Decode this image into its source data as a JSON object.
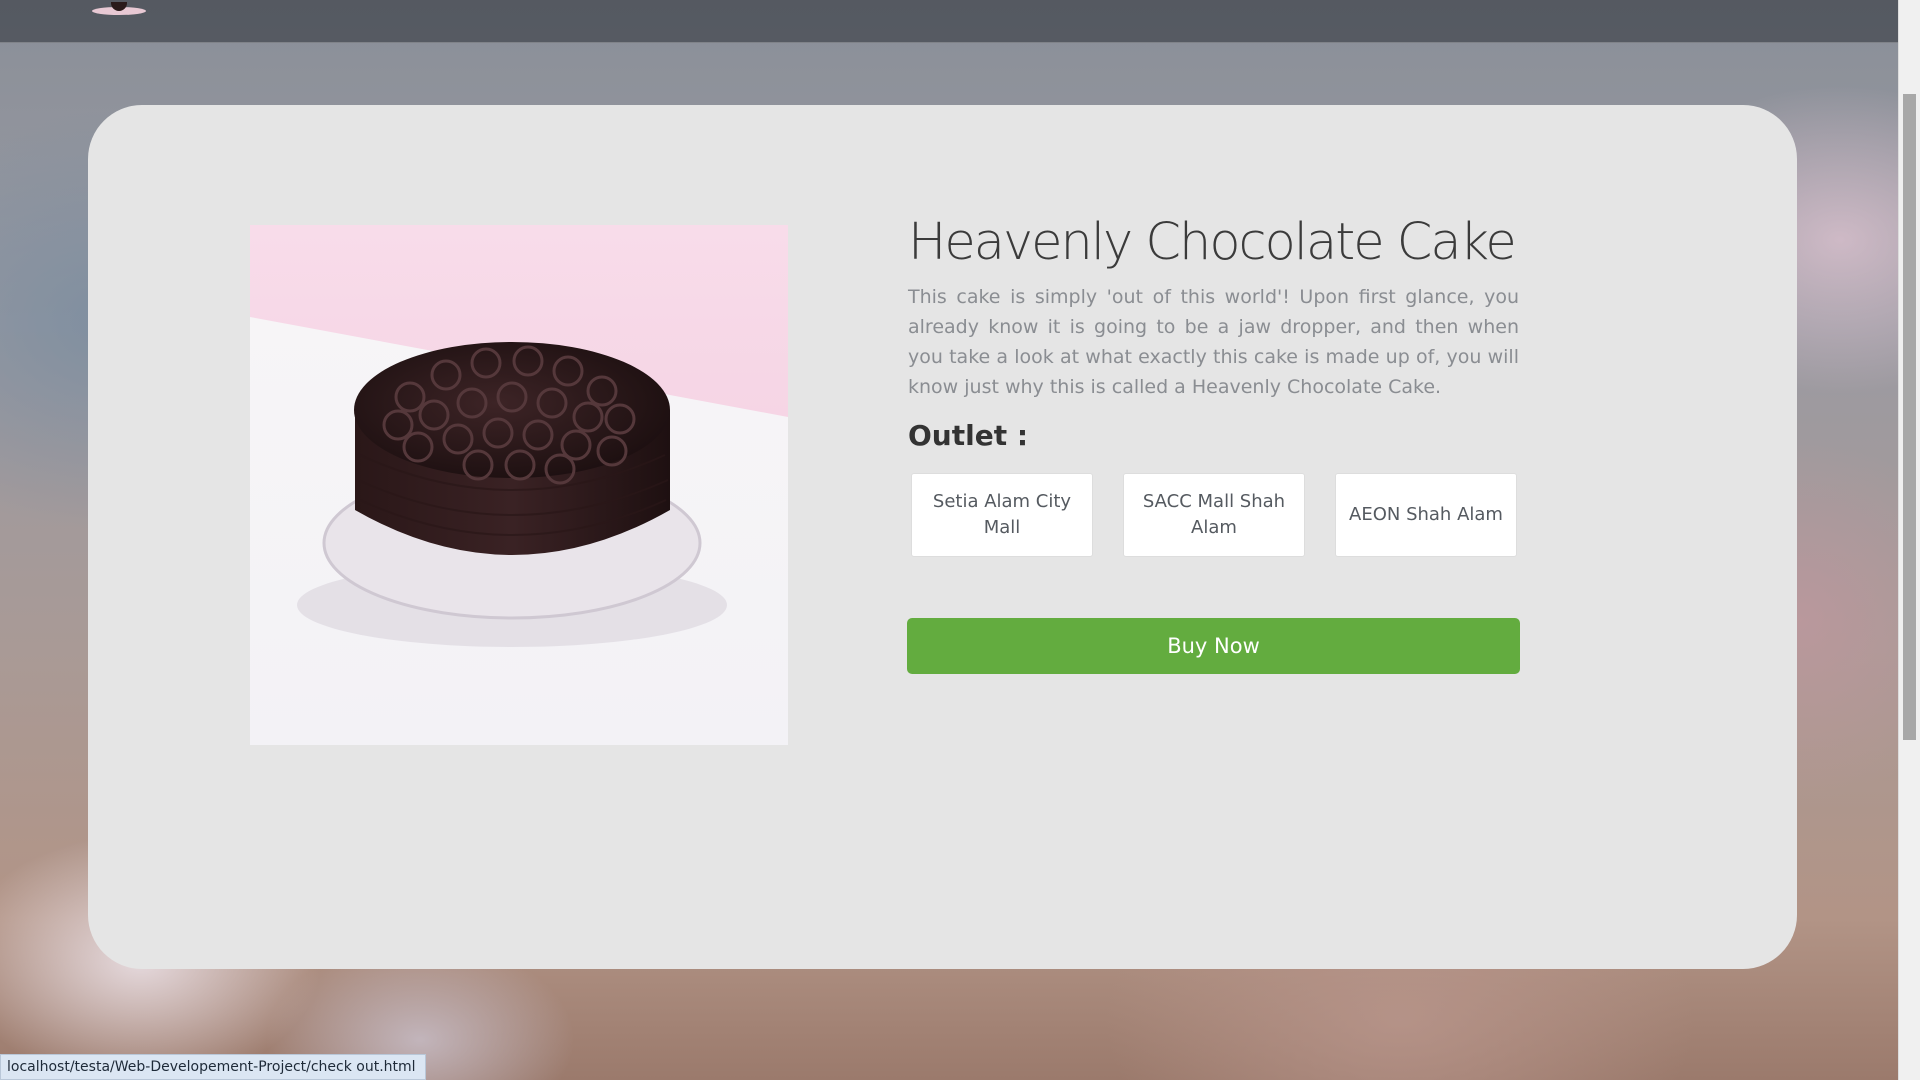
{
  "product": {
    "title": "Heavenly Chocolate Cake",
    "description": "This cake is simply 'out of this world'! Upon first glance, you already know it is going to be a jaw dropper, and then when you take a look at what exactly this cake is made up of, you will know just why this is called a Heavenly Chocolate Cake.",
    "outlet_label": "Outlet :",
    "outlets": [
      "Setia Alam City Mall",
      "SACC Mall Shah Alam",
      "AEON Shah Alam"
    ],
    "buy_label": "Buy Now"
  },
  "status_bar": {
    "url": "localhost/testa/Web-Developement-Project/check out.html"
  },
  "colors": {
    "card_background": "#e5e5e5",
    "buy_button": "#63ac3f",
    "title_text": "#3b3b3b",
    "description_text": "#8a8d92"
  }
}
